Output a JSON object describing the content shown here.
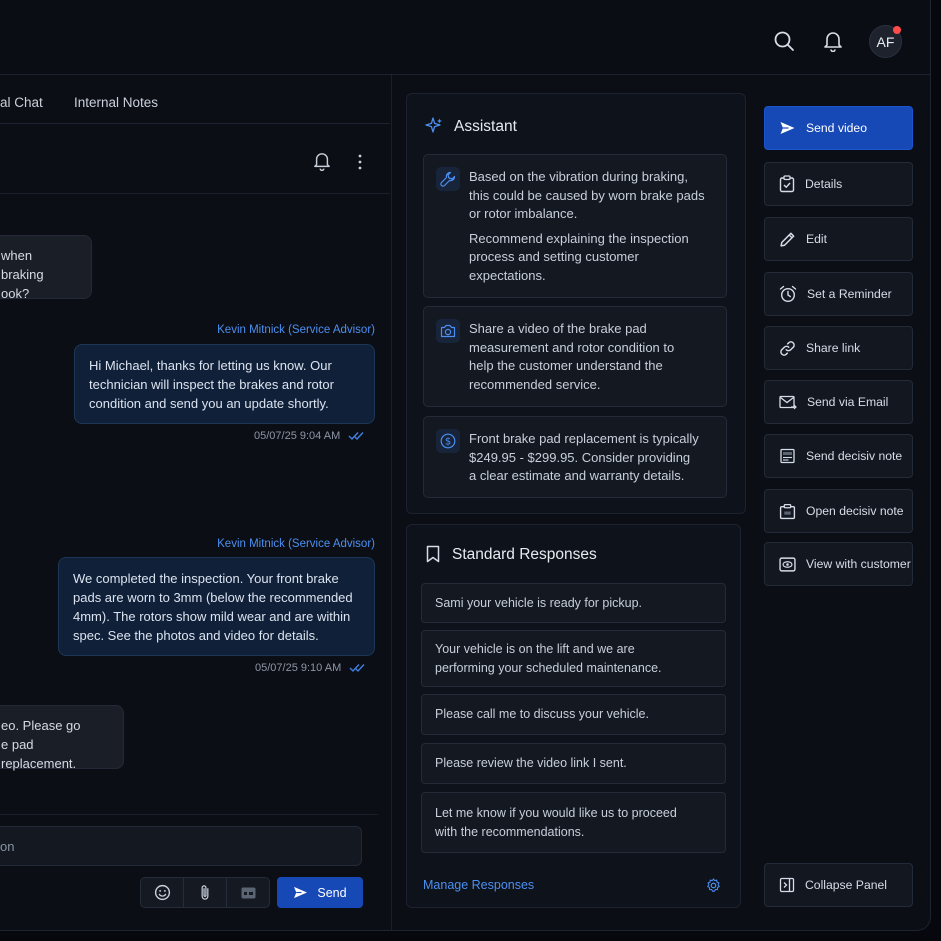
{
  "header": {
    "avatar_initials": "AF",
    "icons": [
      "search-icon",
      "bell-icon"
    ],
    "notification_dot_color": "#ff4b4b"
  },
  "chat": {
    "tabs": [
      {
        "label": "al Chat",
        "active": false
      },
      {
        "label": "Internal Notes",
        "active": false
      }
    ],
    "messages": [
      {
        "direction": "in",
        "lines": [
          "when braking",
          "ook?"
        ]
      },
      {
        "direction": "out",
        "sender": "Kevin Mitnick (Service Advisor)",
        "lines": [
          "Hi Michael, thanks for letting us know. Our",
          "technician will inspect the brakes and rotor",
          "condition and send you an update shortly."
        ],
        "timestamp": "05/07/25 9:04 AM"
      },
      {
        "direction": "out",
        "sender": "Kevin Mitnick (Service Advisor)",
        "lines": [
          "We completed the inspection. Your front brake",
          "pads are worn to 3mm (below the recommended",
          "4mm). The rotors show mild wear and are within",
          "spec. See the photos and video for details."
        ],
        "timestamp": "05/07/25 9:10 AM"
      },
      {
        "direction": "in",
        "lines": [
          "eo. Please go",
          "e pad replacement."
        ]
      }
    ],
    "composer_text": "on",
    "send_label": "Send"
  },
  "assistant": {
    "title": "Assistant",
    "cards": [
      {
        "icon": "wrench-icon",
        "paragraphs": [
          [
            "Based on the vibration during braking,",
            "this could be caused by worn brake pads",
            "or rotor imbalance."
          ],
          [
            "Recommend explaining the inspection",
            "process and setting customer",
            "expectations."
          ]
        ]
      },
      {
        "icon": "camera-icon",
        "paragraphs": [
          [
            "Share a video of the brake pad",
            "measurement and rotor condition to",
            "help the customer understand the",
            "recommended service."
          ]
        ]
      },
      {
        "icon": "dollar-icon",
        "paragraphs": [
          [
            "Front brake pad replacement is typically",
            "$249.95 - $299.95. Consider providing",
            "a clear estimate and warranty details."
          ]
        ]
      }
    ]
  },
  "standard_responses": {
    "title": "Standard Responses",
    "items": [
      [
        "Sami your vehicle is ready for pickup."
      ],
      [
        "Your vehicle is on the lift and we are",
        "performing your scheduled maintenance."
      ],
      [
        "Please call me to discuss your vehicle."
      ],
      [
        "Please review the video link I sent."
      ],
      [
        "Let me know if you would like us to proceed",
        "with the recommendations."
      ]
    ],
    "manage_label": "Manage Responses"
  },
  "actions": [
    {
      "label": "Send video",
      "icon": "send-icon",
      "primary": true
    },
    {
      "label": "Details",
      "icon": "clipboard-icon"
    },
    {
      "label": "Edit",
      "icon": "pencil-icon"
    },
    {
      "label": "Set a Reminder",
      "icon": "alarm-clock-icon"
    },
    {
      "label": "Share link",
      "icon": "link-icon"
    },
    {
      "label": "Send via Email",
      "icon": "email-icon"
    },
    {
      "label": "Send decisiv note",
      "icon": "note-icon"
    },
    {
      "label": "Open decisiv note",
      "icon": "open-note-icon"
    },
    {
      "label": "View with customer",
      "icon": "eye-screen-icon"
    },
    {
      "label": "Collapse Panel",
      "icon": "collapse-panel-icon"
    }
  ],
  "colors": {
    "accent": "#1648b6",
    "link": "#4c8ff0",
    "read_ticks": "#3f7fe0"
  }
}
